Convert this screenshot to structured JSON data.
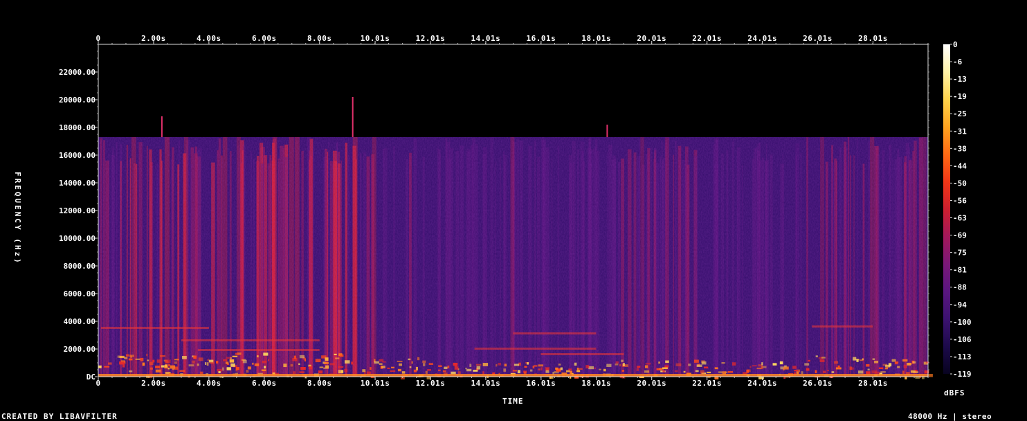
{
  "chart_data": {
    "type": "heatmap",
    "title": "",
    "xlabel": "TIME",
    "ylabel": "FREQUENCY (Hz)",
    "x_ticks": [
      "0",
      "2.00s",
      "4.00s",
      "6.00s",
      "8.00s",
      "10.01s",
      "12.01s",
      "14.01s",
      "16.01s",
      "18.01s",
      "20.01s",
      "22.01s",
      "24.01s",
      "26.01s",
      "28.01s"
    ],
    "y_ticks": [
      "DC",
      "2000.00",
      "4000.00",
      "6000.00",
      "8000.00",
      "10000.00",
      "12000.00",
      "14000.00",
      "16000.00",
      "18000.00",
      "20000.00",
      "22000.00"
    ],
    "x_range_s": [
      0,
      30
    ],
    "y_range_hz": [
      0,
      24000
    ],
    "spectral_cutoff_hz": 17300,
    "colorbar": {
      "label": "dBFS",
      "ticks": [
        "0",
        "-6",
        "-13",
        "-19",
        "-25",
        "-31",
        "-38",
        "-44",
        "-50",
        "-56",
        "-63",
        "-69",
        "-75",
        "-81",
        "-88",
        "-94",
        "-100",
        "-106",
        "-113",
        "-119"
      ],
      "range": [
        0,
        -119
      ],
      "colors": [
        "#ffffff",
        "#fff2a8",
        "#ffd24a",
        "#ffa31f",
        "#ff6a14",
        "#f23616",
        "#cc1f2e",
        "#a3185a",
        "#7a1877",
        "#5a1680",
        "#3c1270",
        "#1c0a4a",
        "#080320"
      ]
    },
    "background_color": "#000000"
  },
  "footer": {
    "credit": "CREATED BY LIBAVFILTER",
    "format": "48000 Hz | stereo"
  }
}
